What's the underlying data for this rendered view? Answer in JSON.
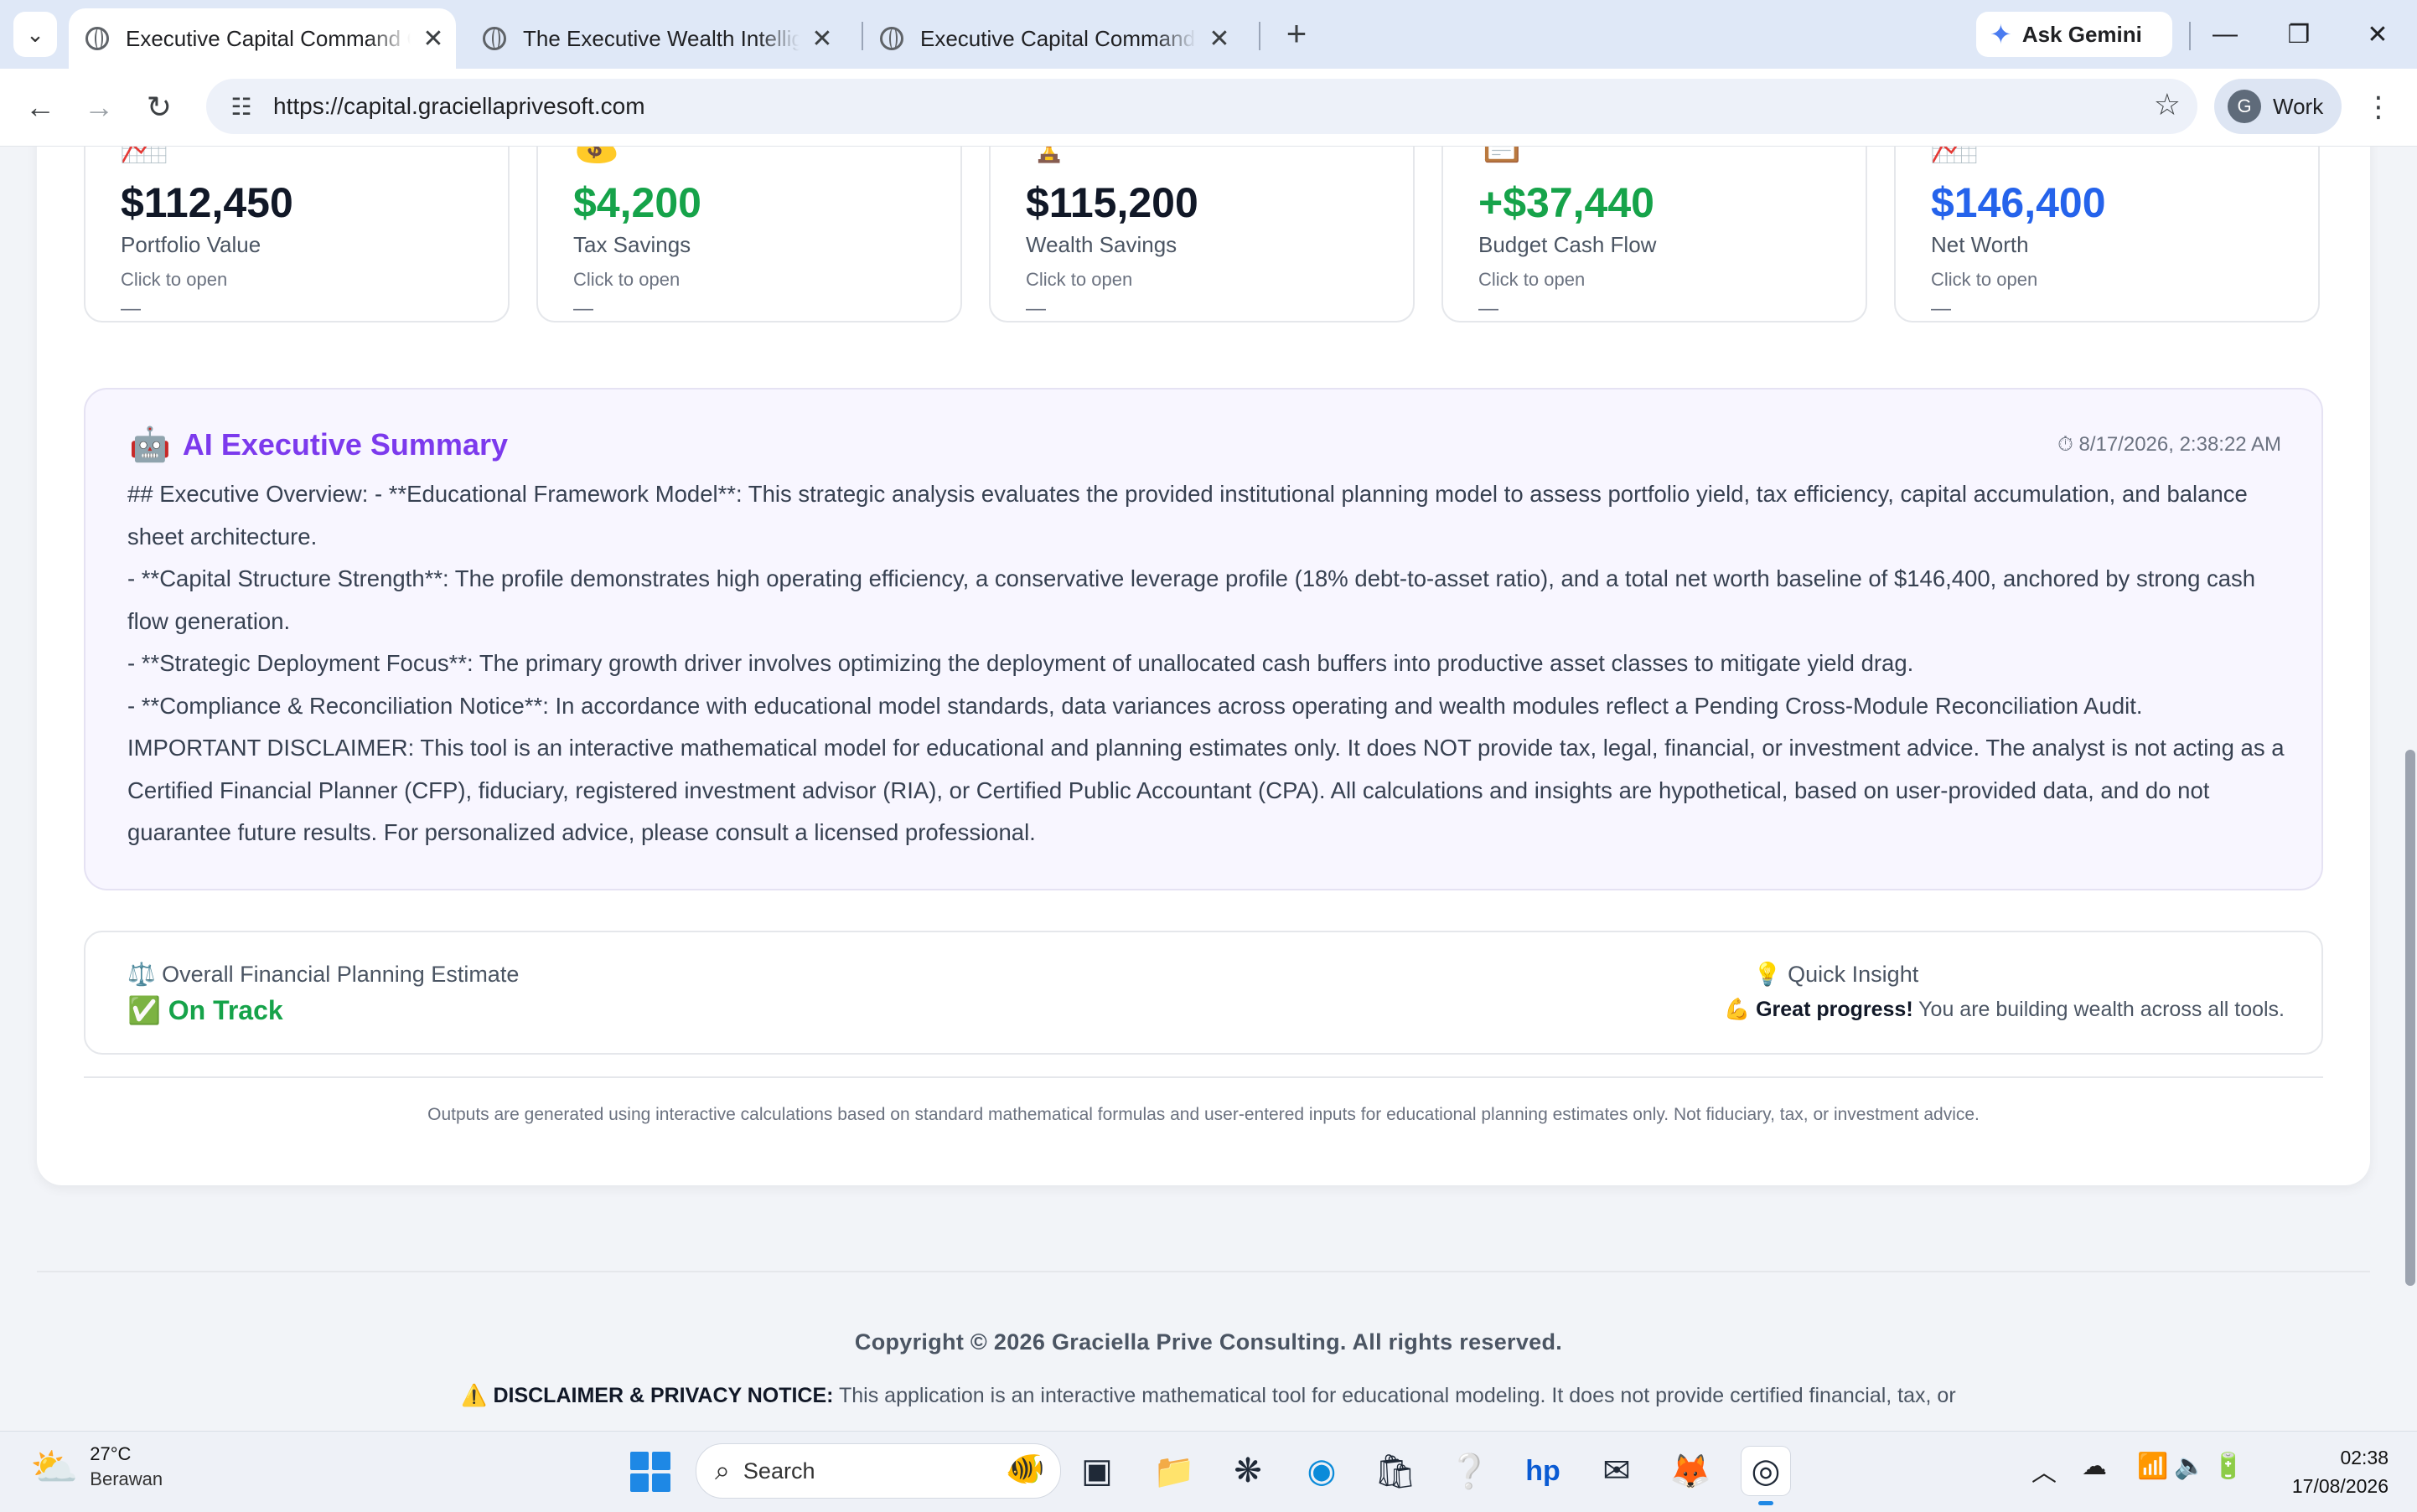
{
  "browser": {
    "tabs": [
      {
        "title": "Executive Capital Command Center",
        "active": true
      },
      {
        "title": "The Executive Wealth Intelligence",
        "active": false
      },
      {
        "title": "Executive Capital Command Center",
        "active": false
      }
    ],
    "ask_gemini": "Ask Gemini",
    "url": "https://capital.graciellaprivesoft.com",
    "profile_initial": "G",
    "profile_name": "Work"
  },
  "kpi_cards": [
    {
      "icon": "📈",
      "value": "$112,450",
      "label": "Portfolio Value",
      "hint": "Click to open",
      "dash": "—",
      "color": "#111827"
    },
    {
      "icon": "💰",
      "value": "$4,200",
      "label": "Tax Savings",
      "hint": "Click to open",
      "dash": "—",
      "color": "#16a34a"
    },
    {
      "icon": "🏆",
      "value": "$115,200",
      "label": "Wealth Savings",
      "hint": "Click to open",
      "dash": "—",
      "color": "#111827"
    },
    {
      "icon": "📋",
      "value": "+$37,440",
      "label": "Budget Cash Flow",
      "hint": "Click to open",
      "dash": "—",
      "color": "#16a34a"
    },
    {
      "icon": "📈",
      "value": "$146,400",
      "label": "Net Worth",
      "hint": "Click to open",
      "dash": "—",
      "color": "#2563eb"
    }
  ],
  "summary": {
    "icon": "🤖",
    "title": "AI Executive Summary",
    "timestamp_icon": "⏱",
    "timestamp": "8/17/2026, 2:38:22 AM",
    "paragraphs": [
      "## Executive Overview: - **Educational Framework Model**: This strategic analysis evaluates the provided institutional planning model to assess portfolio yield, tax efficiency, capital accumulation, and balance sheet architecture.",
      "- **Capital Structure Strength**: The profile demonstrates high operating efficiency, a conservative leverage profile (18% debt-to-asset ratio), and a total net worth baseline of $146,400, anchored by strong cash flow generation.",
      "- **Strategic Deployment Focus**: The primary growth driver involves optimizing the deployment of unallocated cash buffers into productive asset classes to mitigate yield drag.",
      "- **Compliance & Reconciliation Notice**: In accordance with educational model standards, data variances across operating and wealth modules reflect a Pending Cross-Module Reconciliation Audit.",
      "IMPORTANT DISCLAIMER: This tool is an interactive mathematical model for educational and planning estimates only. It does NOT provide tax, legal, financial, or investment advice. The analyst is not acting as a Certified Financial Planner (CFP), fiduciary, registered investment advisor (RIA), or Certified Public Accountant (CPA). All calculations and insights are hypothetical, based on user-provided data, and do not guarantee future results. For personalized advice, please consult a licensed professional."
    ]
  },
  "estimate": {
    "label_icon": "⚖️",
    "label": "Overall Financial Planning Estimate",
    "status_icon": "✅",
    "status": "On Track",
    "insight_icon": "💡",
    "insight_label": "Quick Insight",
    "insight_emoji": "💪",
    "insight_bold": "Great progress!",
    "insight_text": "You are building wealth across all tools."
  },
  "fine_print": "Outputs are generated using interactive calculations based on standard mathematical formulas and user-entered inputs for educational planning estimates only. Not fiduciary, tax, or investment advice.",
  "footer": {
    "copyright": "Copyright © 2026 Graciella Prive Consulting. All rights reserved.",
    "disclaimer_icon": "⚠️",
    "disclaimer_label": "DISCLAIMER & PRIVACY NOTICE:",
    "disclaimer_text": "This application is an interactive mathematical tool for educational modeling. It does not provide certified financial, tax, or"
  },
  "taskbar": {
    "temperature": "27°C",
    "condition": "Berawan",
    "search_placeholder": "Search",
    "time": "02:38",
    "date": "17/08/2026"
  }
}
